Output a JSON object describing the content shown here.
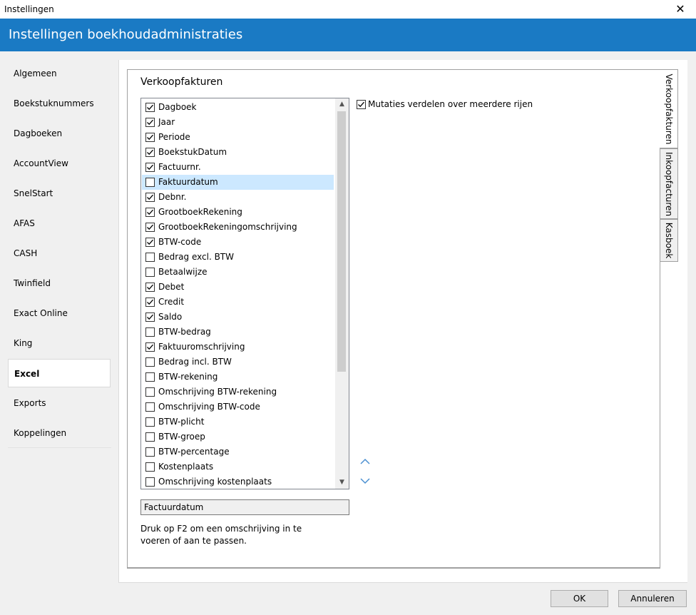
{
  "window": {
    "title": "Instellingen",
    "close_glyph": "✕"
  },
  "header": {
    "title": "Instellingen boekhoudadministraties"
  },
  "sidebar": {
    "items": [
      {
        "label": "Algemeen",
        "active": false
      },
      {
        "label": "Boekstuknummers",
        "active": false
      },
      {
        "label": "Dagboeken",
        "active": false
      },
      {
        "label": "AccountView",
        "active": false
      },
      {
        "label": "SnelStart",
        "active": false
      },
      {
        "label": "AFAS",
        "active": false
      },
      {
        "label": "CASH",
        "active": false
      },
      {
        "label": "Twinfield",
        "active": false
      },
      {
        "label": "Exact Online",
        "active": false
      },
      {
        "label": "King",
        "active": false
      },
      {
        "label": "Excel",
        "active": true
      },
      {
        "label": "Exports",
        "active": false
      },
      {
        "label": "Koppelingen",
        "active": false
      }
    ]
  },
  "tabs": [
    {
      "label": "Verkoopfakturen",
      "active": true
    },
    {
      "label": "Inkoopfacturen",
      "active": false
    },
    {
      "label": "Kasboek",
      "active": false
    }
  ],
  "section": {
    "title": "Verkoopfakturen"
  },
  "fields": [
    {
      "label": "Dagboek",
      "checked": true
    },
    {
      "label": "Jaar",
      "checked": true
    },
    {
      "label": "Periode",
      "checked": true
    },
    {
      "label": "BoekstukDatum",
      "checked": true
    },
    {
      "label": "Factuurnr.",
      "checked": true
    },
    {
      "label": "Faktuurdatum",
      "checked": false,
      "selected": true
    },
    {
      "label": "Debnr.",
      "checked": true
    },
    {
      "label": "GrootboekRekening",
      "checked": true
    },
    {
      "label": "GrootboekRekeningomschrijving",
      "checked": true
    },
    {
      "label": "BTW-code",
      "checked": true
    },
    {
      "label": "Bedrag excl. BTW",
      "checked": false
    },
    {
      "label": "Betaalwijze",
      "checked": false
    },
    {
      "label": "Debet",
      "checked": true
    },
    {
      "label": "Credit",
      "checked": true
    },
    {
      "label": "Saldo",
      "checked": true
    },
    {
      "label": "BTW-bedrag",
      "checked": false
    },
    {
      "label": "Faktuuromschrijving",
      "checked": true
    },
    {
      "label": "Bedrag incl. BTW",
      "checked": false
    },
    {
      "label": "BTW-rekening",
      "checked": false
    },
    {
      "label": "Omschrijving BTW-rekening",
      "checked": false
    },
    {
      "label": "Omschrijving BTW-code",
      "checked": false
    },
    {
      "label": "BTW-plicht",
      "checked": false
    },
    {
      "label": "BTW-groep",
      "checked": false
    },
    {
      "label": "BTW-percentage",
      "checked": false
    },
    {
      "label": "Kostenplaats",
      "checked": false
    },
    {
      "label": "Omschrijving kostenplaats",
      "checked": false
    }
  ],
  "scrollbar": {
    "up_glyph": "▲",
    "down_glyph": "▼"
  },
  "options": {
    "mutaties_label": "Mutaties verdelen over meerdere rijen",
    "mutaties_checked": true
  },
  "description": {
    "value": "Factuurdatum"
  },
  "hint": {
    "text": "Druk op F2 om een omschrijving in te voeren of aan te passen."
  },
  "buttons": {
    "ok": "OK",
    "cancel": "Annuleren"
  },
  "colors": {
    "accent": "#1a7ac4",
    "selection": "#cce8ff",
    "arrows": "#4a8fd1"
  }
}
